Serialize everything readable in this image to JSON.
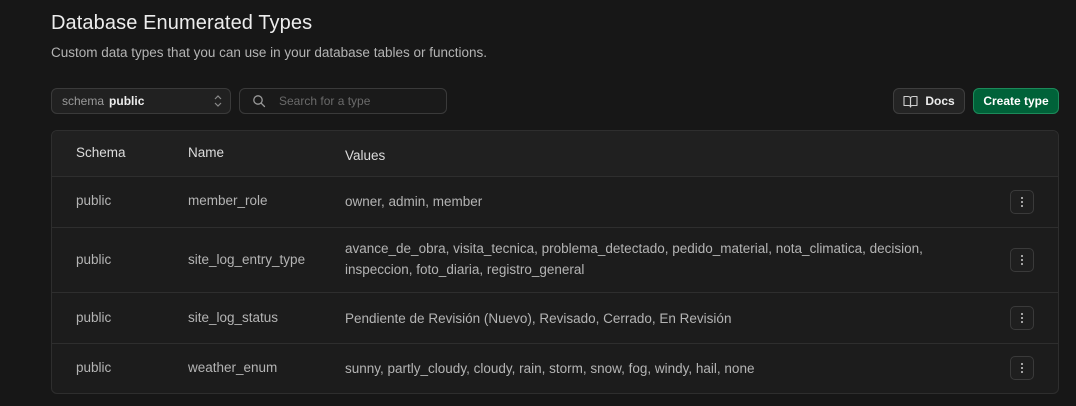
{
  "header": {
    "title": "Database Enumerated Types",
    "subtitle": "Custom data types that you can use in your database tables or functions."
  },
  "toolbar": {
    "schema_label": "schema",
    "schema_value": "public",
    "search_placeholder": "Search for a type",
    "search_value": "",
    "docs_label": "Docs",
    "create_label": "Create type"
  },
  "table": {
    "columns": [
      "Schema",
      "Name",
      "Values"
    ],
    "rows": [
      {
        "schema": "public",
        "name": "member_role",
        "values": "owner, admin, member"
      },
      {
        "schema": "public",
        "name": "site_log_entry_type",
        "values": "avance_de_obra, visita_tecnica, problema_detectado, pedido_material, nota_climatica, decision, inspeccion, foto_diaria, registro_general"
      },
      {
        "schema": "public",
        "name": "site_log_status",
        "values": "Pendiente de Revisión (Nuevo), Revisado, Cerrado, En Revisión"
      },
      {
        "schema": "public",
        "name": "weather_enum",
        "values": "sunny, partly_cloudy, cloudy, rain, storm, snow, fog, windy, hail, none"
      }
    ]
  },
  "icons": {
    "schema_chevron": "chevron-up-down-icon",
    "search": "search-icon",
    "docs": "book-open-icon",
    "row_menu": "more-vertical-icon"
  },
  "colors": {
    "background": "#171717",
    "primary_button": "#006239",
    "border": "#2e2e2e"
  }
}
